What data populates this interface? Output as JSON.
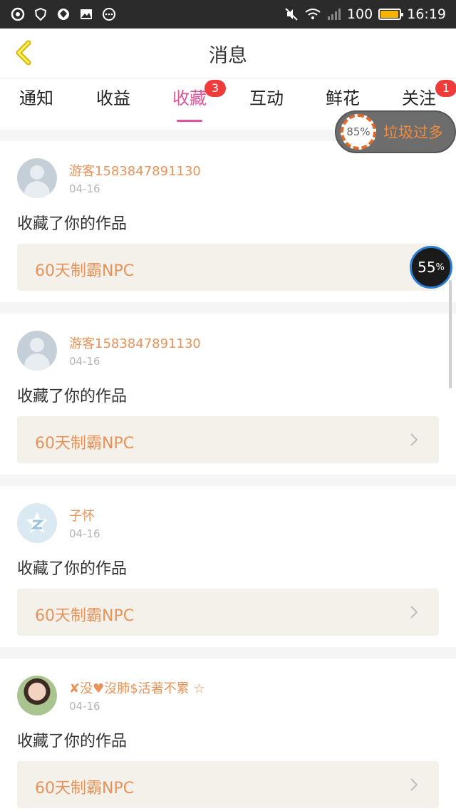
{
  "status_bar": {
    "battery_level": "100",
    "time": "16:19",
    "icons": [
      "app-icon-1",
      "shield-icon",
      "app-icon-2",
      "image-icon",
      "more-dots-icon"
    ],
    "battery_fill_fraction": 0.95
  },
  "header": {
    "title": "消息",
    "back_icon": "chevron-left-icon"
  },
  "tabs": [
    {
      "label": "通知",
      "badge": ""
    },
    {
      "label": "收益",
      "badge": ""
    },
    {
      "label": "收藏",
      "badge": "3"
    },
    {
      "label": "互动",
      "badge": ""
    },
    {
      "label": "鲜花",
      "badge": ""
    },
    {
      "label": "关注",
      "badge": "1"
    }
  ],
  "active_tab": "收藏",
  "cleaner_widget": {
    "percent": "85",
    "percent_sign": "%",
    "text": "垃圾过多"
  },
  "speed_badge": {
    "value": "55",
    "unit": "%"
  },
  "items": [
    {
      "username": "游客1583847891130",
      "date": "04-16",
      "action": "收藏了你的作品",
      "work_title": "60天制霸NPC",
      "avatar": "default"
    },
    {
      "username": "游客1583847891130",
      "date": "04-16",
      "action": "收藏了你的作品",
      "work_title": "60天制霸NPC",
      "avatar": "default"
    },
    {
      "username": "子怀",
      "date": "04-16",
      "action": "收藏了你的作品",
      "work_title": "60天制霸NPC",
      "avatar": "qq"
    },
    {
      "username": "✘没♥沒肺$活著不累 ☆",
      "date": "04-16",
      "action": "收藏了你的作品",
      "work_title": "60天制霸NPC",
      "avatar": "photo"
    }
  ],
  "colors": {
    "accent": "#e0559a",
    "username": "#e8935a",
    "badge": "#f03b3b",
    "work_bg": "#f3f1e9"
  }
}
